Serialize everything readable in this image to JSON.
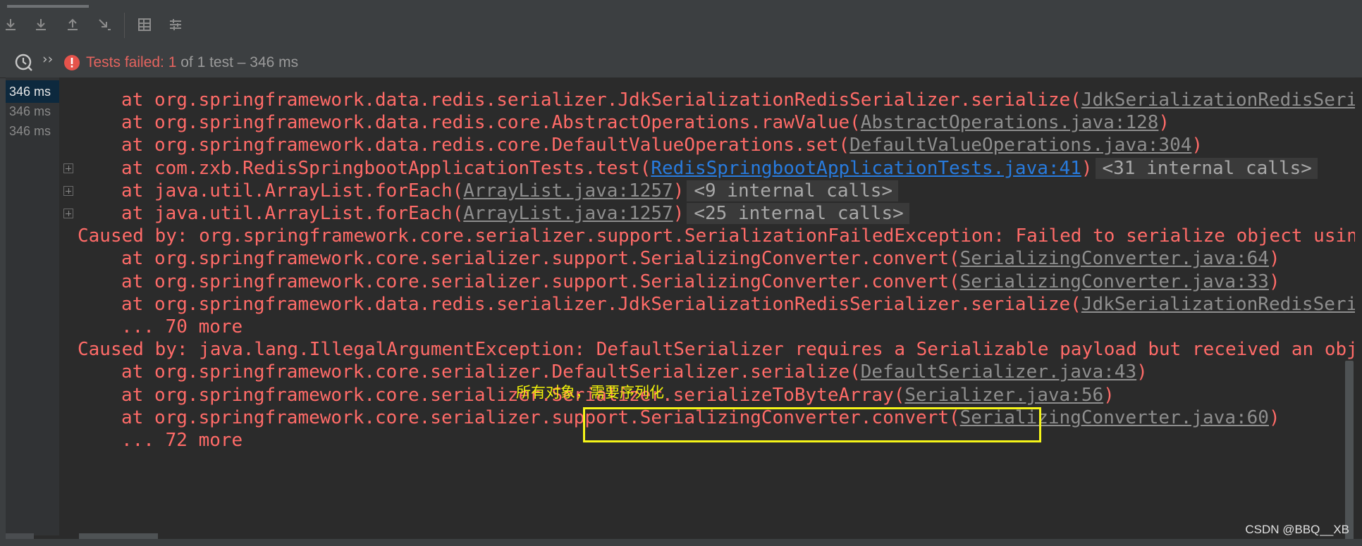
{
  "toolbar": {
    "buttons": [
      {
        "name": "scroll-down-icon"
      },
      {
        "name": "download-icon"
      },
      {
        "name": "upload-icon"
      },
      {
        "name": "step-out-icon"
      },
      {
        "name": "table-icon"
      },
      {
        "name": "filter-settings-icon"
      }
    ]
  },
  "status": {
    "failed_label": "Tests failed: 1",
    "rest_label": " of 1 test – 346 ms",
    "chevron": "››"
  },
  "durations": [
    "346 ms",
    "346 ms",
    "346 ms"
  ],
  "console": {
    "lines": [
      {
        "indent": true,
        "expandable": false,
        "pre": "at org.springframework.data.redis.serializer.JdkSerializationRedisSerializer.serialize(",
        "link": "JdkSerializationRedisSeria",
        "post": "",
        "calls": ""
      },
      {
        "indent": true,
        "expandable": false,
        "pre": "at org.springframework.data.redis.core.AbstractOperations.rawValue(",
        "link": "AbstractOperations.java:128",
        "post": ")",
        "calls": ""
      },
      {
        "indent": true,
        "expandable": false,
        "pre": "at org.springframework.data.redis.core.DefaultValueOperations.set(",
        "link": "DefaultValueOperations.java:304",
        "post": ")",
        "calls": ""
      },
      {
        "indent": true,
        "expandable": true,
        "pre": "at com.zxb.RedisSpringbootApplicationTests.test(",
        "link": "RedisSpringbootApplicationTests.java:41",
        "link_blue": true,
        "post": ")",
        "calls": "<31 internal calls>"
      },
      {
        "indent": true,
        "expandable": true,
        "pre": "at java.util.ArrayList.forEach(",
        "link": "ArrayList.java:1257",
        "post": ")",
        "calls": "<9 internal calls>"
      },
      {
        "indent": true,
        "expandable": true,
        "pre": "at java.util.ArrayList.forEach(",
        "link": "ArrayList.java:1257",
        "post": ")",
        "calls": "<25 internal calls>"
      },
      {
        "indent": false,
        "expandable": false,
        "pre": "Caused by: org.springframework.core.serializer.support.SerializationFailedException: Failed to serialize object using",
        "link": "",
        "post": "",
        "calls": ""
      },
      {
        "indent": true,
        "expandable": false,
        "pre": "at org.springframework.core.serializer.support.SerializingConverter.convert(",
        "link": "SerializingConverter.java:64",
        "post": ")",
        "calls": ""
      },
      {
        "indent": true,
        "expandable": false,
        "pre": "at org.springframework.core.serializer.support.SerializingConverter.convert(",
        "link": "SerializingConverter.java:33",
        "post": ")",
        "calls": ""
      },
      {
        "indent": true,
        "expandable": false,
        "pre": "at org.springframework.data.redis.serializer.JdkSerializationRedisSerializer.serialize(",
        "link": "JdkSerializationRedisSeria",
        "post": "",
        "calls": ""
      },
      {
        "indent": true,
        "expandable": false,
        "pre": "... 70 more",
        "link": "",
        "post": "",
        "calls": ""
      },
      {
        "indent": false,
        "expandable": false,
        "pre": "Caused by: java.lang.IllegalArgumentException: DefaultSerializer requires a Serializable payload but received an obje",
        "link": "",
        "post": "",
        "calls": ""
      },
      {
        "indent": true,
        "expandable": false,
        "pre": "at org.springframework.core.serializer.DefaultSerializer.serialize(",
        "link": "DefaultSerializer.java:43",
        "post": ")",
        "calls": ""
      },
      {
        "indent": true,
        "expandable": false,
        "pre": "at org.springframework.core.serializer.Serializer.serializeToByteArray(",
        "link": "Serializer.java:56",
        "post": ")",
        "calls": ""
      },
      {
        "indent": true,
        "expandable": false,
        "pre": "at org.springframework.core.serializer.support.SerializingConverter.convert(",
        "link": "SerializingConverter.java:60",
        "post": ")",
        "calls": ""
      },
      {
        "indent": true,
        "expandable": false,
        "pre": "... 72 more",
        "link": "",
        "post": "",
        "calls": ""
      }
    ]
  },
  "annotation": "所有对象，需要序列化",
  "watermark": "CSDN @BBQ__XB",
  "colors": {
    "error_text": "#ff6b68",
    "link_gray": "#8e8e8e",
    "link_blue": "#287bde",
    "annotation": "#f1f10a",
    "highlight_box": "#f5f519"
  }
}
